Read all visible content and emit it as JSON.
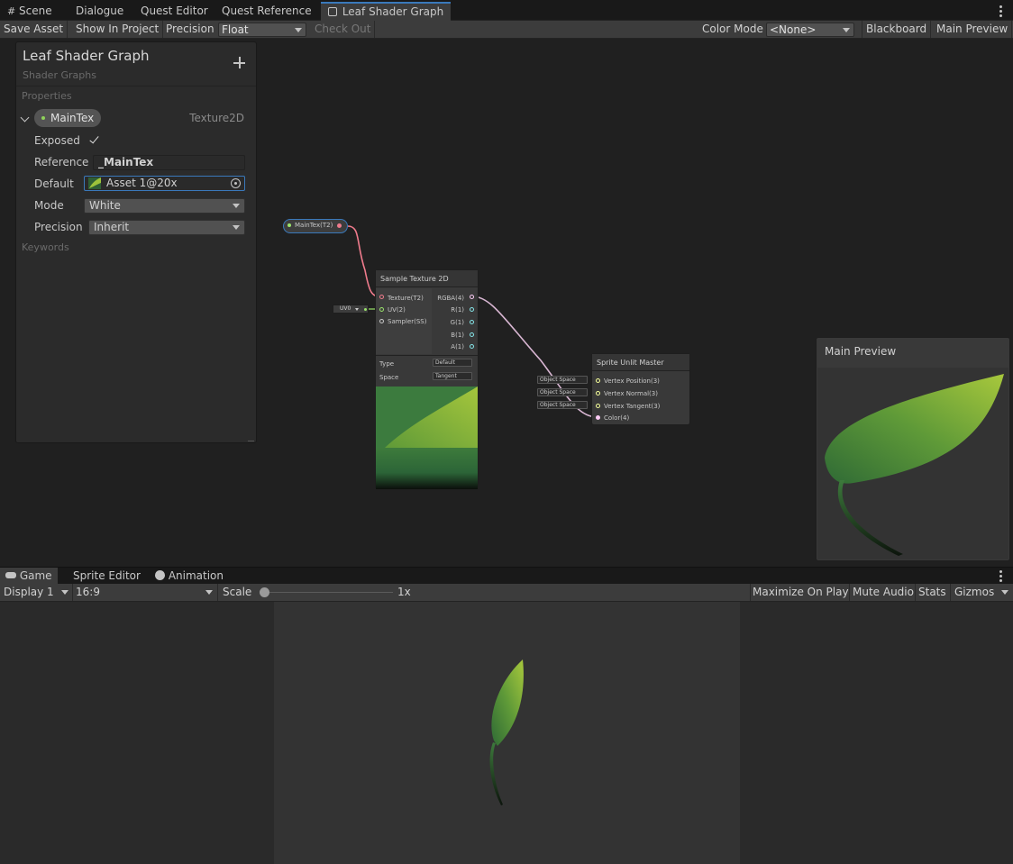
{
  "window_tabs": [
    {
      "label": "Scene",
      "icon": "grid-icon"
    },
    {
      "label": "Dialogue"
    },
    {
      "label": "Quest Editor"
    },
    {
      "label": "Quest Reference"
    },
    {
      "label": "Leaf Shader Graph",
      "icon": "shader-graph-icon",
      "active": true
    }
  ],
  "toolbar": {
    "save_asset": "Save Asset",
    "show_in_project": "Show In Project",
    "precision_label": "Precision",
    "precision_value": "Float",
    "check_out": "Check Out",
    "color_mode_label": "Color Mode",
    "color_mode_value": "<None>",
    "blackboard": "Blackboard",
    "main_preview": "Main Preview"
  },
  "blackboard": {
    "title": "Leaf Shader Graph",
    "subtitle": "Shader Graphs",
    "properties_header": "Properties",
    "keywords_header": "Keywords",
    "property": {
      "name": "MainTex",
      "type": "Texture2D",
      "exposed_label": "Exposed",
      "exposed": true,
      "reference_label": "Reference",
      "reference_value": "_MainTex",
      "default_label": "Default",
      "default_value": "Asset 1@20x",
      "mode_label": "Mode",
      "mode_value": "White",
      "precision_label": "Precision",
      "precision_value": "Inherit"
    }
  },
  "nodes": {
    "property_node": {
      "label": "MainTex(T2)"
    },
    "uv_node": {
      "label": "UV0"
    },
    "sample_texture": {
      "title": "Sample Texture 2D",
      "inputs": [
        "Texture(T2)",
        "UV(2)",
        "Sampler(SS)"
      ],
      "outputs": [
        "RGBA(4)",
        "R(1)",
        "G(1)",
        "B(1)",
        "A(1)"
      ],
      "type_label": "Type",
      "type_value": "Default",
      "space_label": "Space",
      "space_value": "Tangent"
    },
    "master": {
      "title": "Sprite Unlit Master",
      "inputs": [
        "Vertex Position(3)",
        "Vertex Normal(3)",
        "Vertex Tangent(3)",
        "Color(4)"
      ],
      "space_dropdowns": [
        "Object Space",
        "Object Space",
        "Object Space"
      ]
    }
  },
  "main_preview": {
    "title": "Main Preview"
  },
  "game_tabs": [
    {
      "label": "Game",
      "icon": "gamepad-icon",
      "active": true
    },
    {
      "label": "Sprite Editor"
    },
    {
      "label": "Animation",
      "icon": "clock-icon"
    }
  ],
  "game_toolbar": {
    "display": "Display 1",
    "aspect": "16:9",
    "scale_label": "Scale",
    "scale_value": "1x",
    "scale_slider": 0.0,
    "maximize_on_play": "Maximize On Play",
    "mute_audio": "Mute Audio",
    "stats": "Stats",
    "gizmos": "Gizmos"
  },
  "colors": {
    "accent": "#3a79bb",
    "texture_port": "#ef7b8c",
    "vector2_port": "#9ae36b",
    "vector4_port": "#fbcbf4",
    "float_port": "#84e4e7",
    "vector3_port": "#f6ff9a",
    "leaf_light": "#9dc33b",
    "leaf_dark": "#2f6a35"
  }
}
